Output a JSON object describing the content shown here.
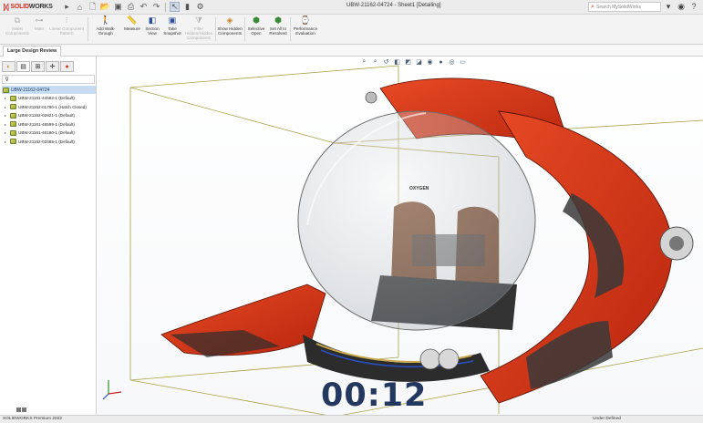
{
  "titlebar": {
    "logo_brand": "SOLID",
    "logo_brand_bold": "WORKS",
    "document_title": "UBW-21162-04724 - Sheet1 [Detailing]",
    "search_placeholder": "Search MySolidWorks"
  },
  "ribbon": {
    "buttons": [
      {
        "label": "Insert Components",
        "icon": "insert-components-icon",
        "enabled": false
      },
      {
        "label": "Mate",
        "icon": "mate-icon",
        "enabled": false
      },
      {
        "label": "Linear Component Pattern",
        "icon": "linear-pattern-icon",
        "enabled": false
      },
      {
        "label": "Add Walk-through",
        "icon": "walk-through-icon",
        "enabled": true
      },
      {
        "label": "Measure",
        "icon": "measure-icon",
        "enabled": true
      },
      {
        "label": "Section View",
        "icon": "section-view-icon",
        "enabled": true
      },
      {
        "label": "Take Snapshot",
        "icon": "snapshot-icon",
        "enabled": true
      },
      {
        "label": "Filter Hidden/Hidden Components",
        "icon": "filter-icon",
        "enabled": false
      },
      {
        "label": "Show Hidden Components",
        "icon": "show-hidden-icon",
        "enabled": true
      },
      {
        "label": "Selective Open",
        "icon": "selective-open-icon",
        "enabled": true
      },
      {
        "label": "Set All to Resolved",
        "icon": "set-resolved-icon",
        "enabled": true
      },
      {
        "label": "Performance Evaluation",
        "icon": "performance-icon",
        "enabled": true
      }
    ]
  },
  "command_manager": {
    "active_tab": "Large Design Review"
  },
  "feature_manager": {
    "filter_symbol": "⊽",
    "root": "UBW-21162-04724",
    "components": [
      "UBW-21161-44582-1 (Default)",
      "UBW-21162-01780-1 (Hatch Closed)",
      "UBW-21162-02821-1 (Default)",
      "UBW-21161-46599-1 (Default)",
      "UBW-21161-46180-1 (Default)",
      "UBW-21162-03485-1 (Default)"
    ]
  },
  "viewport": {
    "timer": "00:12",
    "badge_text": "OXYGEN"
  },
  "status": {
    "product": "SOLIDWORKS Premium 2022",
    "state": "Under Defined"
  },
  "colors": {
    "brand_red": "#d52b1e",
    "hull_red": "#d8361a",
    "selection_blue": "#c7dcf3",
    "timer": "#23385e"
  }
}
